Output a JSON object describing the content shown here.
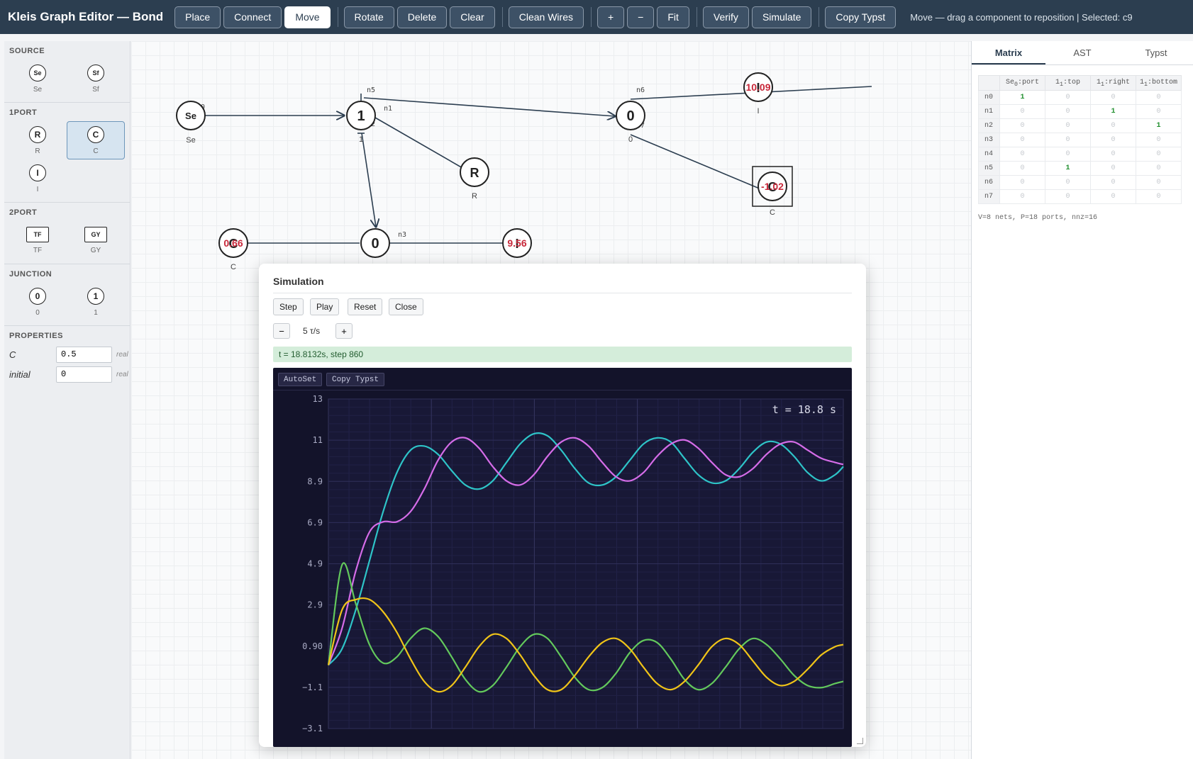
{
  "app": {
    "title": "Kleis Graph Editor — Bond"
  },
  "toolbar": {
    "place": "Place",
    "connect": "Connect",
    "move": "Move",
    "rotate": "Rotate",
    "delete": "Delete",
    "clear": "Clear",
    "clean_wires": "Clean Wires",
    "zoom_in": "+",
    "zoom_out": "−",
    "fit": "Fit",
    "verify": "Verify",
    "simulate": "Simulate",
    "copy_typst": "Copy Typst",
    "active_mode": "Move",
    "status": "Move — drag a component to reposition | Selected: c9"
  },
  "palette": {
    "source": {
      "title": "SOURCE",
      "items": [
        {
          "glyph": "Se",
          "label": "Se"
        },
        {
          "glyph": "Sf",
          "label": "Sf"
        }
      ]
    },
    "oneport": {
      "title": "1PORT",
      "items": [
        {
          "glyph": "R",
          "label": "R"
        },
        {
          "glyph": "C",
          "label": "C"
        },
        {
          "glyph": "I",
          "label": "I"
        }
      ]
    },
    "twoport": {
      "title": "2PORT",
      "items": [
        {
          "glyph": "TF",
          "label": "TF"
        },
        {
          "glyph": "GY",
          "label": "GY"
        }
      ]
    },
    "junction": {
      "title": "JUNCTION",
      "items": [
        {
          "glyph": "0",
          "label": "0"
        },
        {
          "glyph": "1",
          "label": "1"
        }
      ]
    },
    "selected_item": "C",
    "properties": {
      "title": "PROPERTIES",
      "rows": [
        {
          "label": "C",
          "value": "0.5",
          "type": "real"
        },
        {
          "label": "initial",
          "value": "0",
          "type": "real"
        }
      ]
    }
  },
  "graph": {
    "nodes": [
      {
        "id": "se",
        "glyph": "Se",
        "label": "Se",
        "value": "",
        "selected": false
      },
      {
        "id": "j1",
        "glyph": "1",
        "label": "1",
        "value": "",
        "selected": false
      },
      {
        "id": "j0a",
        "glyph": "0",
        "label": "0",
        "value": "",
        "selected": false
      },
      {
        "id": "i",
        "glyph": "I",
        "label": "I",
        "value": "10.09",
        "selected": false
      },
      {
        "id": "r",
        "glyph": "R",
        "label": "R",
        "value": "",
        "selected": false
      },
      {
        "id": "c9",
        "glyph": "C",
        "label": "C",
        "value": "-1.02",
        "selected": true
      },
      {
        "id": "c2",
        "glyph": "C",
        "label": "C",
        "value": "0.66",
        "selected": false
      },
      {
        "id": "j0b",
        "glyph": "0",
        "label": "",
        "value": "",
        "selected": false
      },
      {
        "id": "i2",
        "glyph": "I",
        "label": "",
        "value": "9.56",
        "selected": false
      }
    ],
    "nets": [
      "n0",
      "n1",
      "n2",
      "n3",
      "n4",
      "n5",
      "n6",
      "n7"
    ]
  },
  "right_panel": {
    "tabs": [
      "Matrix",
      "AST",
      "Typst"
    ],
    "active_tab": "Matrix",
    "matrix": {
      "columns": [
        {
          "base": "Se",
          "sub": "0",
          "port": ":port"
        },
        {
          "base": "1",
          "sub": "1",
          "port": ":top"
        },
        {
          "base": "1",
          "sub": "1",
          "port": ":right"
        },
        {
          "base": "1",
          "sub": "1",
          "port": ":bottom"
        }
      ],
      "rows": [
        {
          "net": "n0",
          "values": [
            "1",
            "0",
            "0",
            "0"
          ]
        },
        {
          "net": "n1",
          "values": [
            "0",
            "0",
            "1",
            "0"
          ]
        },
        {
          "net": "n2",
          "values": [
            "0",
            "0",
            "0",
            "1"
          ]
        },
        {
          "net": "n3",
          "values": [
            "0",
            "0",
            "0",
            "0"
          ]
        },
        {
          "net": "n4",
          "values": [
            "0",
            "0",
            "0",
            "0"
          ]
        },
        {
          "net": "n5",
          "values": [
            "0",
            "1",
            "0",
            "0"
          ]
        },
        {
          "net": "n6",
          "values": [
            "0",
            "0",
            "0",
            "0"
          ]
        },
        {
          "net": "n7",
          "values": [
            "0",
            "0",
            "0",
            "0"
          ]
        }
      ],
      "stats": "V=8 nets, P=18 ports, nnz=16"
    }
  },
  "simulation": {
    "title": "Simulation",
    "buttons": {
      "step": "Step",
      "play": "Play",
      "reset": "Reset",
      "close": "Close",
      "slower": "−",
      "faster": "+"
    },
    "rate": "5 τ/s",
    "status": "t = 18.8132s, step 860",
    "plot_buttons": {
      "autoset": "AutoSet",
      "copy_typst": "Copy Typst"
    },
    "time_label": "t = 18.8 s"
  },
  "chart_data": {
    "type": "line",
    "title": "",
    "xlabel": "",
    "ylabel": "",
    "xlim": [
      0,
      18.8
    ],
    "ylim": [
      -3.1,
      13
    ],
    "yticks": [
      "13",
      "11",
      "8.9",
      "6.9",
      "4.9",
      "2.9",
      "0.90",
      "−1.1",
      "−3.1"
    ],
    "grid": true,
    "background": "#13132a",
    "series": [
      {
        "color": "#2ec4c8",
        "x": [
          0,
          0.5,
          1,
          1.5,
          2,
          2.5,
          3,
          3.5,
          4,
          4.5,
          5,
          5.5,
          6,
          6.5,
          7,
          7.5,
          8,
          8.5,
          9,
          9.5,
          10,
          10.5,
          11,
          11.5,
          12,
          12.5,
          13,
          13.5,
          14,
          14.5,
          15,
          15.5,
          16,
          16.5,
          17,
          17.5,
          18,
          18.5,
          18.8
        ],
        "y": [
          0,
          0.8,
          2.7,
          5.1,
          7.5,
          9.4,
          10.5,
          10.7,
          10.3,
          9.5,
          8.8,
          8.6,
          9.0,
          9.9,
          10.8,
          11.3,
          11.2,
          10.5,
          9.6,
          8.9,
          8.8,
          9.2,
          10.0,
          10.8,
          11.1,
          10.9,
          10.1,
          9.3,
          8.9,
          9.0,
          9.6,
          10.4,
          10.9,
          10.8,
          10.2,
          9.4,
          9.0,
          9.3,
          9.7
        ]
      },
      {
        "color": "#d56ce8",
        "x": [
          0,
          0.5,
          1,
          1.5,
          2,
          2.5,
          3,
          3.5,
          4,
          4.5,
          5,
          5.5,
          6,
          6.5,
          7,
          7.5,
          8,
          8.5,
          9,
          9.5,
          10,
          10.5,
          11,
          11.5,
          12,
          12.5,
          13,
          13.5,
          14,
          14.5,
          15,
          15.5,
          16,
          16.5,
          17,
          17.5,
          18,
          18.5,
          18.8
        ],
        "y": [
          0,
          1.8,
          4.6,
          6.5,
          7.0,
          7.0,
          7.5,
          8.6,
          10.0,
          10.9,
          11.1,
          10.6,
          9.7,
          9.0,
          8.8,
          9.3,
          10.2,
          10.9,
          11.1,
          10.7,
          9.9,
          9.2,
          9.0,
          9.4,
          10.2,
          10.8,
          11.0,
          10.6,
          9.9,
          9.3,
          9.2,
          9.6,
          10.3,
          10.8,
          10.9,
          10.5,
          10.1,
          9.9,
          9.8
        ]
      },
      {
        "color": "#63c95c",
        "x": [
          0,
          0.5,
          1,
          1.5,
          2,
          2.5,
          3,
          3.5,
          4,
          4.5,
          5,
          5.5,
          6,
          6.5,
          7,
          7.5,
          8,
          8.5,
          9,
          9.5,
          10,
          10.5,
          11,
          11.5,
          12,
          12.5,
          13,
          13.5,
          14,
          14.5,
          15,
          15.5,
          16,
          16.5,
          17,
          17.5,
          18,
          18.5,
          18.8
        ],
        "y": [
          0,
          4.9,
          3.0,
          1.0,
          0.1,
          0.4,
          1.3,
          1.8,
          1.4,
          0.4,
          -0.7,
          -1.3,
          -1.0,
          -0.1,
          0.9,
          1.5,
          1.3,
          0.4,
          -0.6,
          -1.2,
          -1.1,
          -0.4,
          0.6,
          1.2,
          1.1,
          0.3,
          -0.7,
          -1.2,
          -0.9,
          -0.1,
          0.8,
          1.3,
          1.0,
          0.3,
          -0.5,
          -1.0,
          -1.1,
          -0.9,
          -0.8
        ]
      },
      {
        "color": "#f0c418",
        "x": [
          0,
          0.5,
          1,
          1.5,
          2,
          2.5,
          3,
          3.5,
          4,
          4.5,
          5,
          5.5,
          6,
          6.5,
          7,
          7.5,
          8,
          8.5,
          9,
          9.5,
          10,
          10.5,
          11,
          11.5,
          12,
          12.5,
          13,
          13.5,
          14,
          14.5,
          15,
          15.5,
          16,
          16.5,
          17,
          17.5,
          18,
          18.5,
          18.8
        ],
        "y": [
          0,
          2.7,
          3.2,
          3.2,
          2.6,
          1.6,
          0.3,
          -0.8,
          -1.3,
          -1.0,
          -0.1,
          0.9,
          1.5,
          1.3,
          0.5,
          -0.5,
          -1.2,
          -1.2,
          -0.5,
          0.4,
          1.1,
          1.3,
          0.8,
          -0.1,
          -0.9,
          -1.2,
          -0.8,
          0.0,
          0.9,
          1.3,
          1.0,
          0.2,
          -0.6,
          -1.0,
          -0.8,
          -0.2,
          0.5,
          0.9,
          1.0
        ]
      }
    ]
  }
}
